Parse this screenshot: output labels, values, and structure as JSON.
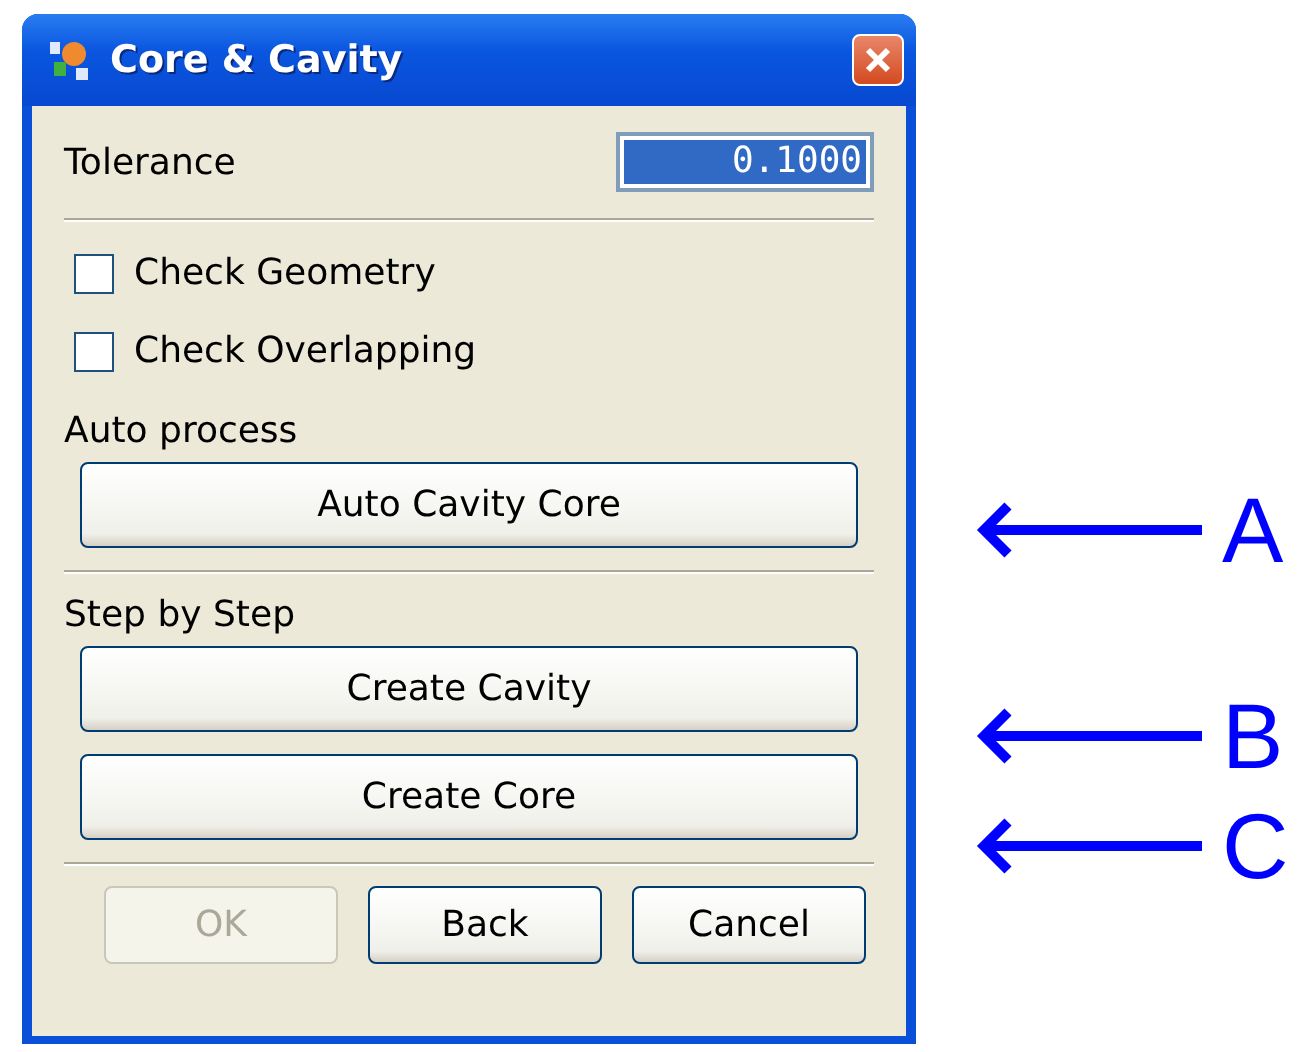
{
  "window": {
    "title": "Core & Cavity"
  },
  "tolerance": {
    "label": "Tolerance",
    "value": "0.1000"
  },
  "checkboxes": [
    {
      "label": "Check Geometry",
      "checked": false
    },
    {
      "label": "Check Overlapping",
      "checked": false
    }
  ],
  "sections": [
    {
      "heading": "Auto process",
      "buttons": [
        "Auto Cavity Core"
      ]
    },
    {
      "heading": "Step by Step",
      "buttons": [
        "Create Cavity",
        "Create Core"
      ]
    }
  ],
  "footer_buttons": [
    {
      "label": "OK",
      "disabled": true
    },
    {
      "label": "Back",
      "disabled": false
    },
    {
      "label": "Cancel",
      "disabled": false
    }
  ],
  "callouts": [
    {
      "letter": "A"
    },
    {
      "letter": "B"
    },
    {
      "letter": "C"
    }
  ]
}
